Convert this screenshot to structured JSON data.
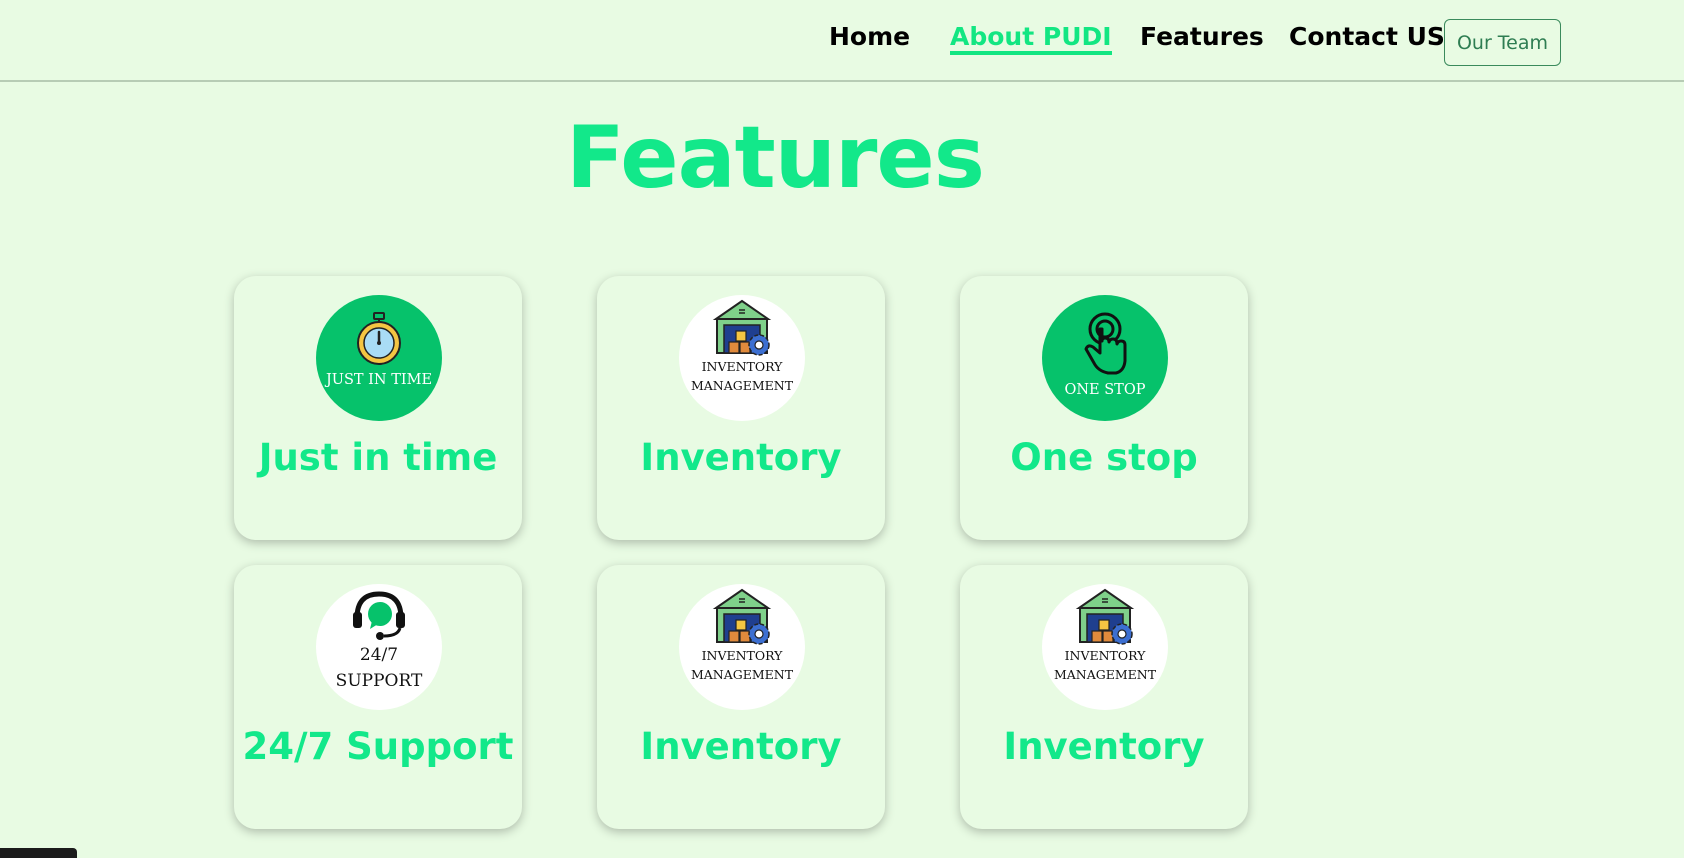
{
  "nav": {
    "links": [
      {
        "label": "Home"
      },
      {
        "label": "About PUDI"
      },
      {
        "label": "Features"
      },
      {
        "label": "Contact US"
      }
    ],
    "active_link": "About PUDI",
    "team_button": "Our Team"
  },
  "page": {
    "title": "Features"
  },
  "cards": [
    {
      "title": "Just in time",
      "icon": "stopwatch-icon",
      "badge_text": [
        "JUST IN TIME"
      ]
    },
    {
      "title": "Inventory",
      "icon": "warehouse-icon",
      "badge_text": [
        "INVENTORY",
        "MANAGEMENT"
      ]
    },
    {
      "title": "One stop",
      "icon": "touch-hand-icon",
      "badge_text": [
        "ONE STOP"
      ]
    },
    {
      "title": "24/7 Support",
      "icon": "headset-chat-icon",
      "badge_text": [
        "24/7",
        "SUPPORT"
      ]
    },
    {
      "title": "Inventory",
      "icon": "warehouse-icon",
      "badge_text": [
        "INVENTORY",
        "MANAGEMENT"
      ]
    },
    {
      "title": "Inventory",
      "icon": "warehouse-icon",
      "badge_text": [
        "INVENTORY",
        "MANAGEMENT"
      ]
    }
  ],
  "colors": {
    "background": "#e8fbe3",
    "accent": "#12e88a",
    "badge_green": "#06c26b",
    "team_button": "#2e7d52"
  }
}
